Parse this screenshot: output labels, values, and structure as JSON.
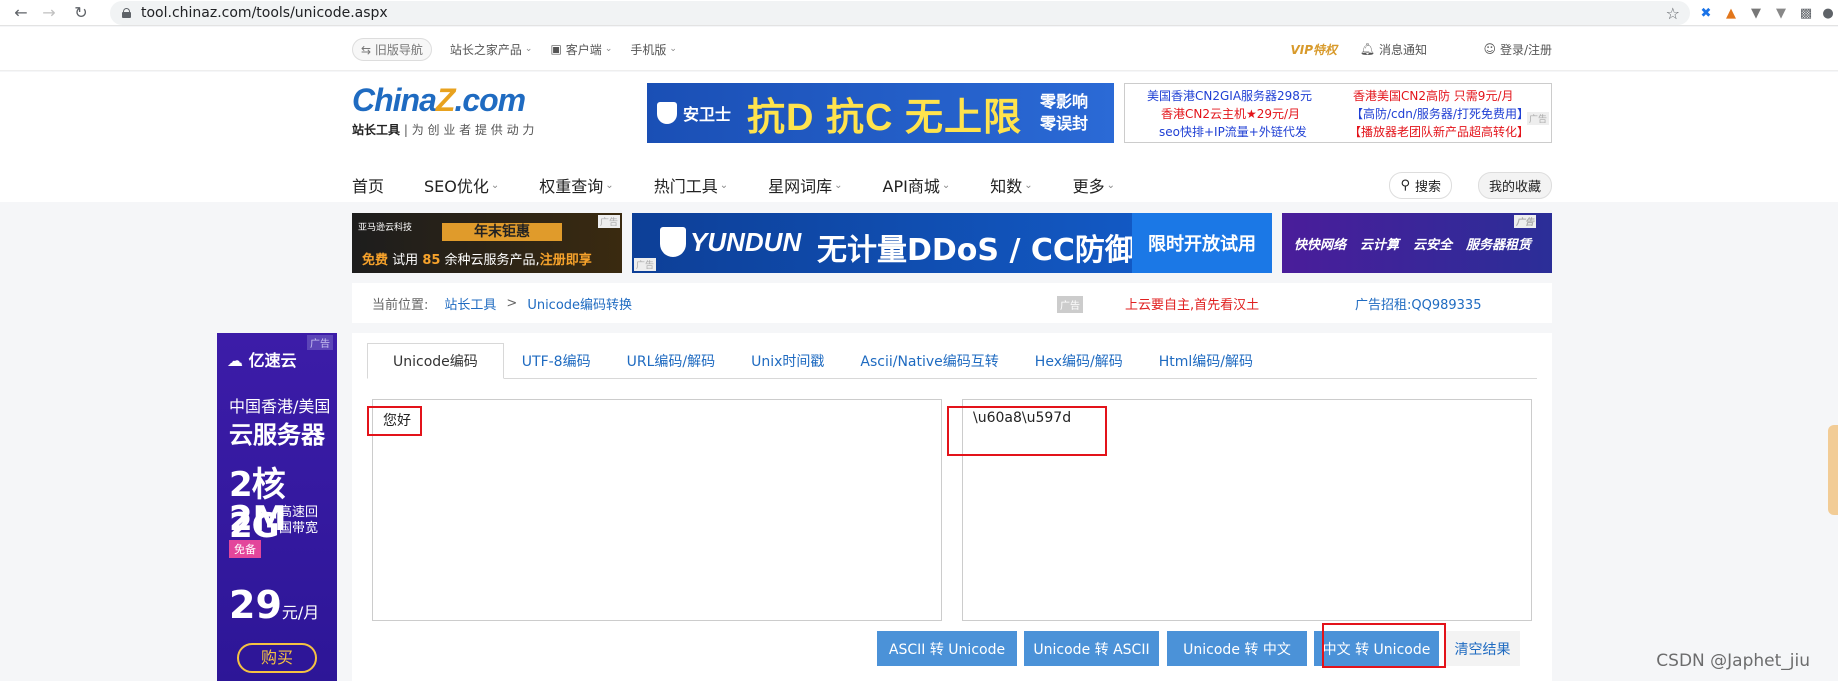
{
  "browser": {
    "url": "tool.chinaz.com/tools/unicode.aspx"
  },
  "topbar": {
    "old_nav": "旧版导航",
    "products": "站长之家产品",
    "client": "客户端",
    "mobile": "手机版",
    "vip": "VIP特权",
    "messages": "消息通知",
    "login": "登录/注册"
  },
  "logo": {
    "text_a": "China",
    "text_b": "Z",
    "text_c": ".com",
    "sub_bold": "站长工具",
    "sub": "| 为 创 业 者 提 供 动 力"
  },
  "banner": {
    "brand": "安卫士",
    "headline": "抗D 抗C 无上限",
    "side1": "零影响",
    "side2": "零误封"
  },
  "ad_links": {
    "a1": "美国香港CN2GIA服务器298元",
    "a2": "香港CN2云主机★29元/月",
    "a3": "seo快排+IP流量+外链代发",
    "b1": "香港美国CN2高防 只需9元/月",
    "b2": "【高防/cdn/服务器/打死免费用】",
    "b3": "【播放器老团队新产品超高转化】",
    "tag": "广告"
  },
  "nav": {
    "items": [
      "首页",
      "SEO优化",
      "权重查询",
      "热门工具",
      "星网词库",
      "API商城",
      "知数",
      "更多"
    ],
    "search": "搜索",
    "favorites": "我的收藏"
  },
  "ads_row": {
    "ad1_top": "亚马逊云科技",
    "ad1_badge": "年末钜惠",
    "ad1_free": "免费",
    "ad1_text": "试用",
    "ad1_num": "85",
    "ad1_text2": "余种云服务产品,",
    "ad1_cta": "注册即享",
    "ad2_brand": "YUNDUN",
    "ad2_text": "无计量DDoS / CC防御",
    "ad2_cta": "限时开放试用",
    "ad3_items": [
      "快快网络",
      "云计算",
      "云安全",
      "服务器租赁"
    ],
    "tag": "广告"
  },
  "breadcrumb": {
    "label": "当前位置:",
    "home": "站长工具",
    "sep": ">",
    "current": "Unicode编码转换",
    "ad_badge": "广告",
    "red_text": "上云要自主,首先看汉土",
    "blue_text": "广告招租:QQ989335"
  },
  "left_ad": {
    "brand": "亿速云",
    "tag": "广告",
    "line1": "中国香港/美国",
    "line2": "云服务器",
    "line3": "2核 2G",
    "line4": "2M",
    "line4_small": "高速回\n国带宽",
    "free": "免备",
    "price": "29",
    "price_unit": "元/月",
    "buy": "购买"
  },
  "tool": {
    "tabs": [
      "Unicode编码",
      "UTF-8编码",
      "URL编码/解码",
      "Unix时间戳",
      "Ascii/Native编码互转",
      "Hex编码/解码",
      "Html编码/解码"
    ],
    "active_tab": 0,
    "input_value": "您好",
    "output_value": "\\u60a8\\u597d",
    "buttons": {
      "ascii_to_unicode": "ASCII 转 Unicode",
      "unicode_to_ascii": "Unicode 转 ASCII",
      "unicode_to_chinese": "Unicode 转 中文",
      "chinese_to_unicode": "中文 转 Unicode",
      "clear": "清空结果"
    },
    "highlight_color": "#e3131a"
  },
  "watermark": "CSDN @Japhet_jiu"
}
